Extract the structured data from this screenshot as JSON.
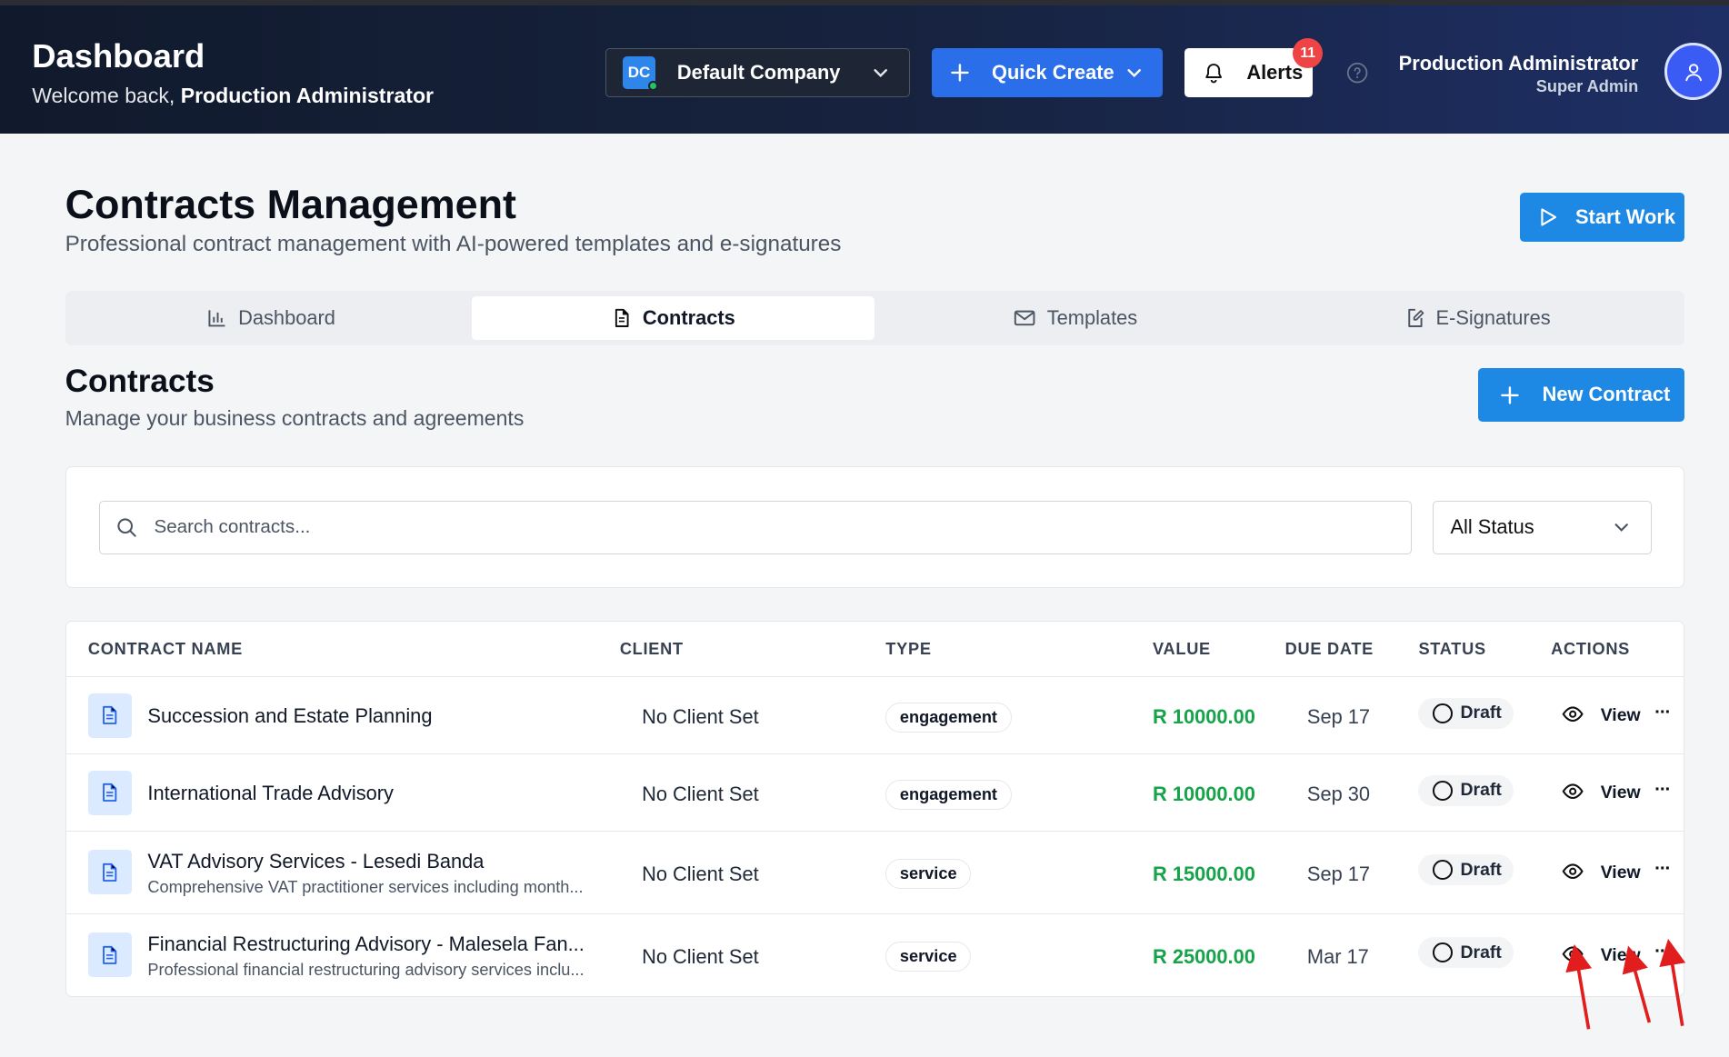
{
  "header": {
    "title": "Dashboard",
    "welcome_prefix": "Welcome back,",
    "welcome_name": "Production Administrator",
    "company_initials": "DC",
    "company_name": "Default Company",
    "quick_create_label": "Quick Create",
    "alerts_label": "Alerts",
    "alerts_count": "11",
    "user_name": "Production Administrator",
    "user_role": "Super Admin"
  },
  "page": {
    "title": "Contracts Management",
    "subtitle": "Professional contract management with AI-powered templates and e-signatures",
    "start_work_label": "Start Work"
  },
  "tabs": [
    {
      "label": "Dashboard",
      "icon": "bar-chart-icon",
      "active": false
    },
    {
      "label": "Contracts",
      "icon": "document-icon",
      "active": true
    },
    {
      "label": "Templates",
      "icon": "mail-icon",
      "active": false
    },
    {
      "label": "E-Signatures",
      "icon": "edit-document-icon",
      "active": false
    }
  ],
  "section": {
    "title": "Contracts",
    "subtitle": "Manage your business contracts and agreements",
    "new_contract_label": "New Contract"
  },
  "filters": {
    "search_placeholder": "Search contracts...",
    "status_selected": "All Status"
  },
  "table": {
    "columns": [
      "CONTRACT NAME",
      "CLIENT",
      "TYPE",
      "VALUE",
      "DUE DATE",
      "STATUS",
      "ACTIONS"
    ],
    "rows": [
      {
        "name": "Succession and Estate Planning",
        "description": "",
        "client": "No Client Set",
        "type": "engagement",
        "value": "R 10000.00",
        "due_date": "Sep 17",
        "status": "Draft",
        "view_label": "View",
        "more": "···"
      },
      {
        "name": "International Trade Advisory",
        "description": "",
        "client": "No Client Set",
        "type": "engagement",
        "value": "R 10000.00",
        "due_date": "Sep 30",
        "status": "Draft",
        "view_label": "View",
        "more": "···"
      },
      {
        "name": "VAT Advisory Services - Lesedi Banda",
        "description": "Comprehensive VAT practitioner services including month...",
        "client": "No Client Set",
        "type": "service",
        "value": "R 15000.00",
        "due_date": "Sep 17",
        "status": "Draft",
        "view_label": "View",
        "more": "···"
      },
      {
        "name": "Financial Restructuring Advisory - Malesela Fan...",
        "description": "Professional financial restructuring advisory services inclu...",
        "client": "No Client Set",
        "type": "service",
        "value": "R 25000.00",
        "due_date": "Mar 17",
        "status": "Draft",
        "view_label": "View",
        "more": "···"
      }
    ]
  },
  "colors": {
    "accent": "#1e88e5",
    "quick_create": "#2b6ee9",
    "value_green": "#16a34a",
    "badge_red": "#ef4444",
    "annotation_arrow": "#e11d1d"
  }
}
